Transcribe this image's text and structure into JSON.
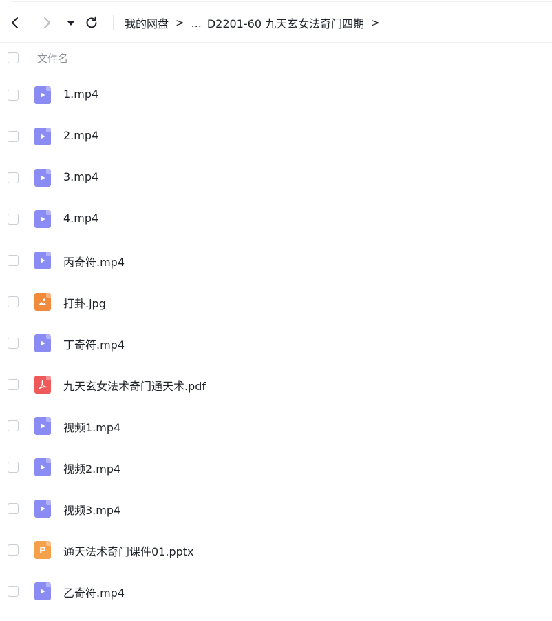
{
  "toolbar": {
    "back_icon": "chevron-left-icon",
    "forward_icon": "chevron-right-icon",
    "dropdown_icon": "caret-down-icon",
    "refresh_icon": "refresh-icon"
  },
  "breadcrumb": {
    "root": "我的网盘",
    "ellipsis": "...",
    "current": "D2201-60 九天玄女法奇门四期",
    "separator": ">"
  },
  "list_header": {
    "column_name": "文件名"
  },
  "files": [
    {
      "name": "1.mp4",
      "type": "video"
    },
    {
      "name": "2.mp4",
      "type": "video"
    },
    {
      "name": "3.mp4",
      "type": "video"
    },
    {
      "name": "4.mp4",
      "type": "video"
    },
    {
      "name": "丙奇符.mp4",
      "type": "video"
    },
    {
      "name": "打卦.jpg",
      "type": "image"
    },
    {
      "name": "丁奇符.mp4",
      "type": "video"
    },
    {
      "name": "九天玄女法术奇门通天术.pdf",
      "type": "pdf"
    },
    {
      "name": "视频1.mp4",
      "type": "video"
    },
    {
      "name": "视频2.mp4",
      "type": "video"
    },
    {
      "name": "视频3.mp4",
      "type": "video"
    },
    {
      "name": "通天法术奇门课件01.pptx",
      "type": "ppt"
    },
    {
      "name": "乙奇符.mp4",
      "type": "video"
    }
  ],
  "colors": {
    "video": "#8b8cf3",
    "image": "#f28a3b",
    "pdf": "#ee5a5a",
    "ppt": "#f5a04b"
  }
}
